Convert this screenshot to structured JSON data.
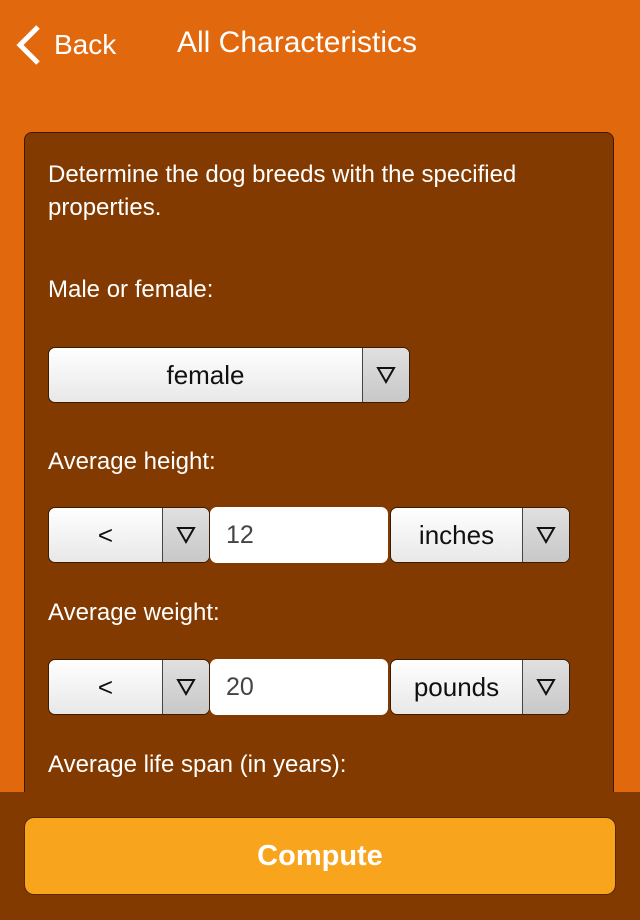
{
  "navbar": {
    "back_label": "Back",
    "title": "All Characteristics"
  },
  "form": {
    "intro": "Determine the dog breeds with the specified properties.",
    "sex": {
      "label": "Male or female:",
      "value": "female"
    },
    "height": {
      "label": "Average height:",
      "comparator": "<",
      "value": "12",
      "unit": "inches"
    },
    "weight": {
      "label": "Average weight:",
      "comparator": "<",
      "value": "20",
      "unit": "pounds"
    },
    "lifespan": {
      "label": "Average life span (in years):"
    }
  },
  "actions": {
    "compute_label": "Compute"
  },
  "colors": {
    "background": "#e2680e",
    "panel": "#833a01",
    "button": "#f8a51d"
  }
}
